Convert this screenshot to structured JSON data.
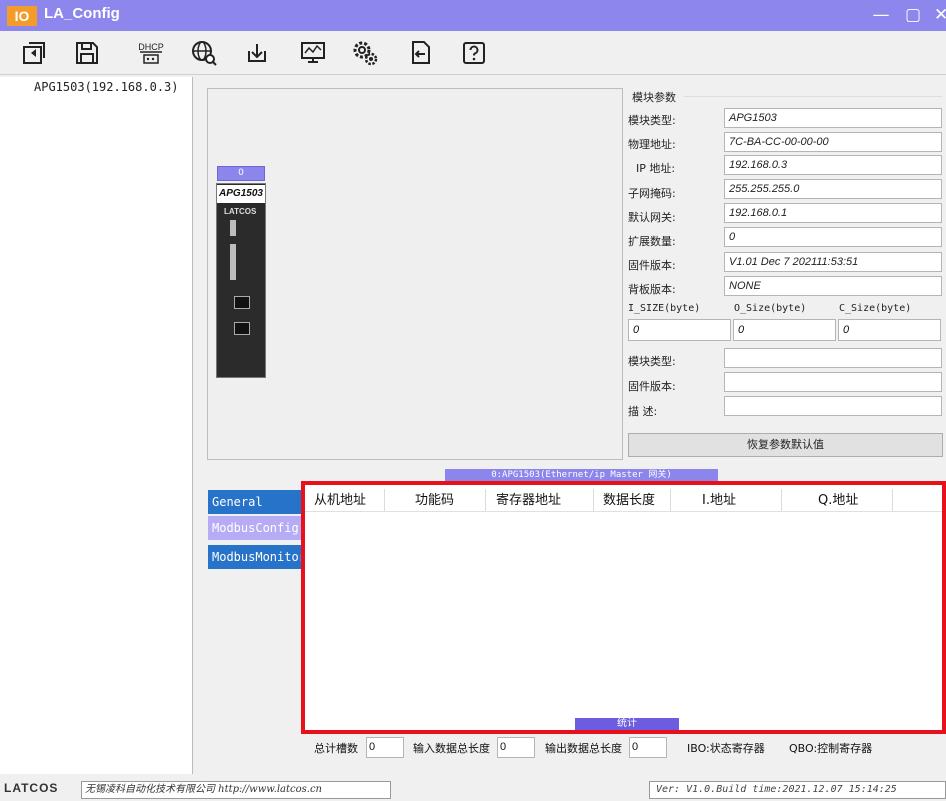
{
  "titlebar": {
    "icon_text": "IO",
    "title": "LA_Config",
    "minimize": "—",
    "maximize": "▢",
    "close": "✕"
  },
  "toolbar": {
    "dhcp_label_top": "DHCP"
  },
  "tree": {
    "device": "APG1503(192.168.0.3)"
  },
  "module": {
    "slot_number": "0",
    "name": "APG1503",
    "brand": "LATCOS"
  },
  "params": {
    "legend": "模块参数",
    "fields": [
      {
        "label": "模块类型:",
        "value": "APG1503"
      },
      {
        "label": "物理地址:",
        "value": "7C-BA-CC-00-00-00"
      },
      {
        "label": "IP 地址:",
        "value": "192.168.0.3"
      },
      {
        "label": "子网掩码:",
        "value": "255.255.255.0"
      },
      {
        "label": "默认网关:",
        "value": "192.168.0.1"
      },
      {
        "label": "扩展数量:",
        "value": "0"
      },
      {
        "label": "固件版本:",
        "value": "V1.01 Dec  7 202111:53:51"
      },
      {
        "label": "背板版本:",
        "value": "NONE"
      }
    ],
    "sizes": [
      {
        "label": "I_SIZE(byte)",
        "value": "0"
      },
      {
        "label": "O_Size(byte)",
        "value": "0"
      },
      {
        "label": "C_Size(byte)",
        "value": "0"
      }
    ],
    "ext_fields": [
      {
        "label": "模块类型:",
        "value": ""
      },
      {
        "label": "固件版本:",
        "value": ""
      },
      {
        "label": "描    述:",
        "value": ""
      }
    ],
    "restore_button": "恢复参数默认值"
  },
  "connection_label": "0:APG1503(Ethernet/ip Master 网关)",
  "side_tabs": [
    {
      "label": "General",
      "color": "#2673c9"
    },
    {
      "label": "ModbusConfig",
      "color": "#b6acf6"
    },
    {
      "label": "ModbusMonitor",
      "color": "#2673c9"
    }
  ],
  "table": {
    "columns": [
      "从机地址",
      "功能码",
      "寄存器地址",
      "数据长度",
      "I.地址",
      "Q.地址"
    ],
    "rows": []
  },
  "stats_tab": "统计",
  "summary": {
    "slots_label": "总计槽数",
    "slots_value": "0",
    "input_label": "输入数据总长度",
    "input_value": "0",
    "output_label": "输出数据总长度",
    "output_value": "0",
    "ibo_label": "IBO:状态寄存器",
    "qbo_label": "QBO:控制寄存器"
  },
  "statusbar": {
    "brand": "LATCOS",
    "company": "无锡凌科自动化技术有限公司 http://www.latcos.cn",
    "version": "Ver: V1.0.Build time:2021.12.07 15:14:25"
  },
  "colors": {
    "titlebar": "#8d86ec",
    "accent": "#6b5ce0",
    "highlight_frame": "#e8101a"
  }
}
